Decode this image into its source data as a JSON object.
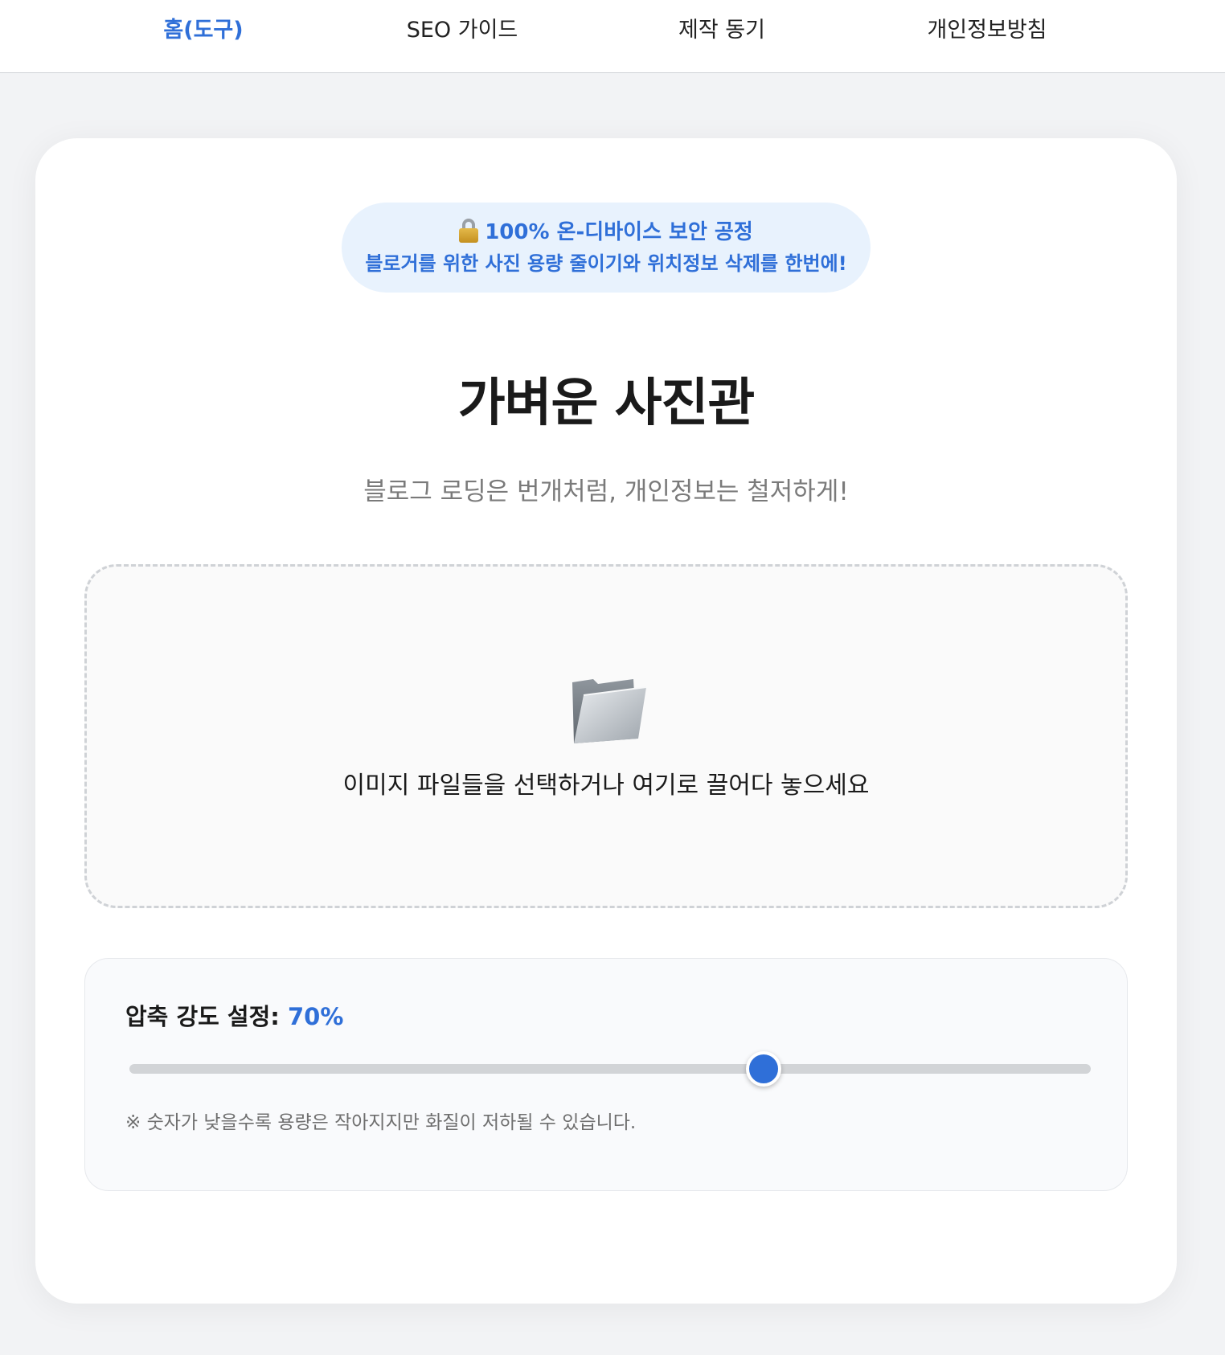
{
  "nav": {
    "items": [
      {
        "label": "홈(도구)",
        "active": true
      },
      {
        "label": "SEO 가이드",
        "active": false
      },
      {
        "label": "제작 동기",
        "active": false
      },
      {
        "label": "개인정보방침",
        "active": false
      }
    ]
  },
  "badge": {
    "icon": "lock-icon",
    "line1": "100% 온-디바이스 보안 공정",
    "line2": "블로거를 위한 사진 용량 줄이기와 위치정보 삭제를 한번에!"
  },
  "hero": {
    "title": "가벼운 사진관",
    "subtitle": "블로그 로딩은 번개처럼, 개인정보는 철저하게!"
  },
  "dropzone": {
    "icon": "open-folder-icon",
    "text": "이미지 파일들을 선택하거나 여기로 끌어다 놓으세요"
  },
  "compression": {
    "label": "압축 강도 설정:",
    "value_text": "70%",
    "value": 0.66,
    "note": "※ 숫자가 낮을수록 용량은 작아지지만 화질이 저하될 수 있습니다."
  },
  "colors": {
    "accent": "#2f6fd8",
    "badge_bg": "#e8f2fd",
    "page_bg": "#f2f3f5"
  }
}
